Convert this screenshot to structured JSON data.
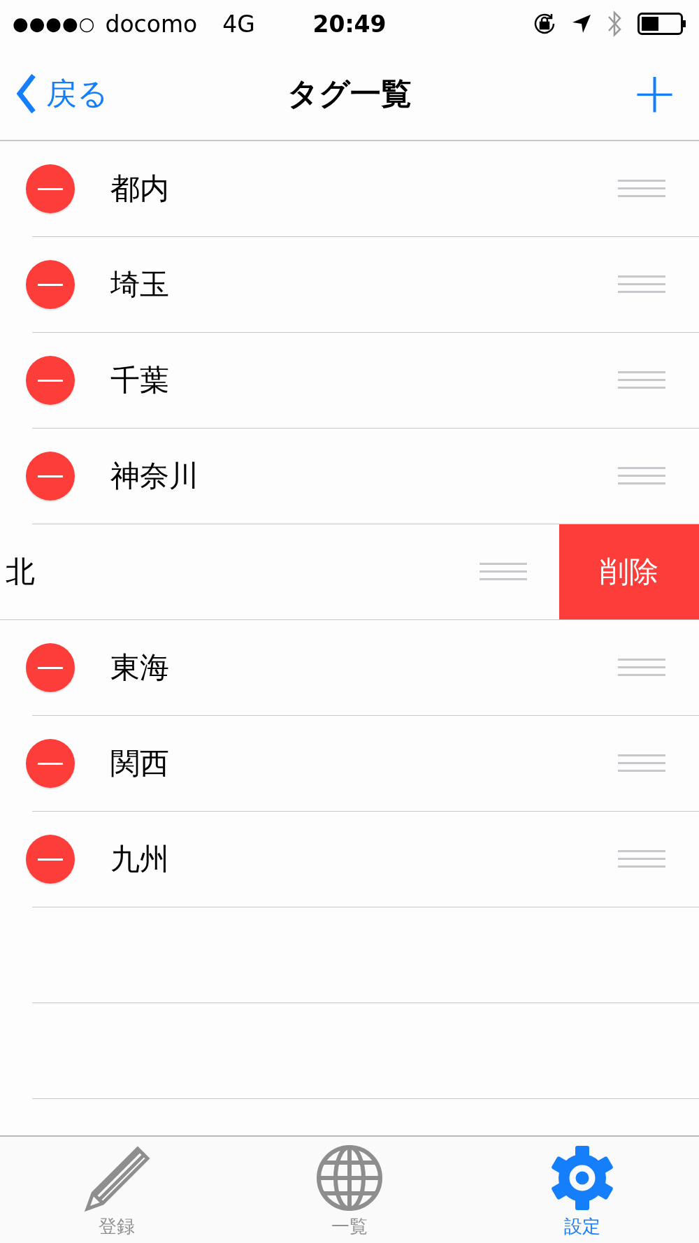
{
  "status_bar": {
    "signal": "●●●●○",
    "carrier": "docomo",
    "network": "4G",
    "time": "20:49"
  },
  "nav": {
    "back": "戻る",
    "title": "タグ一覧",
    "add": "+"
  },
  "rows": [
    {
      "kind": "editing",
      "label": "都内"
    },
    {
      "kind": "editing",
      "label": "埼玉"
    },
    {
      "kind": "editing",
      "label": "千葉"
    },
    {
      "kind": "editing",
      "label": "神奈川"
    },
    {
      "kind": "swiped",
      "label": "北",
      "action": "削除"
    },
    {
      "kind": "editing",
      "label": "東海"
    },
    {
      "kind": "editing",
      "label": "関西"
    },
    {
      "kind": "editing",
      "label": "九州"
    }
  ],
  "tab_bar": [
    {
      "kind": "pencil",
      "label": "登録",
      "selected": false
    },
    {
      "kind": "globe",
      "label": "一覧",
      "selected": false
    },
    {
      "kind": "gear",
      "label": "設定",
      "selected": true
    }
  ]
}
